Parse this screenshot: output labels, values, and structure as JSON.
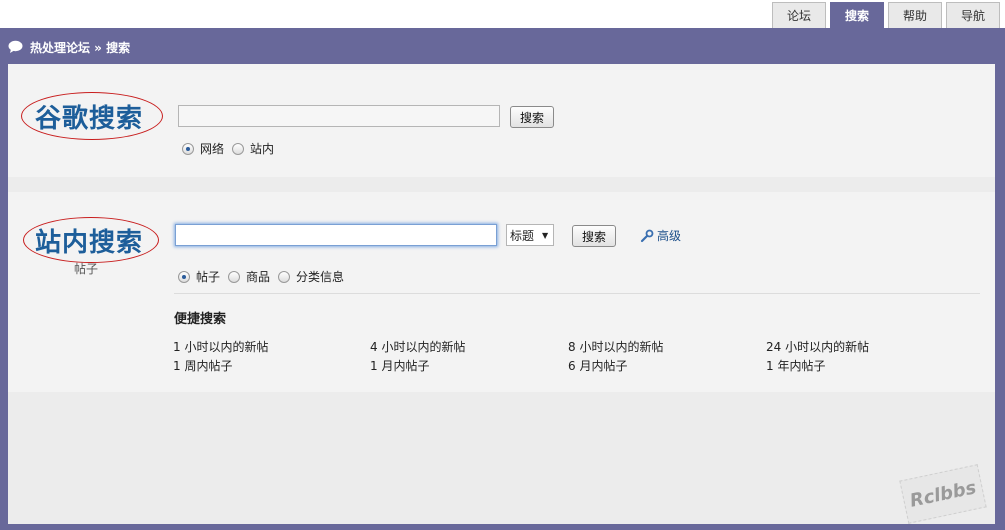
{
  "tabs": [
    {
      "label": "论坛"
    },
    {
      "label": "搜索"
    },
    {
      "label": "帮助"
    },
    {
      "label": "导航"
    }
  ],
  "breadcrumb": {
    "text": "热处理论坛 » 搜索"
  },
  "google_search": {
    "title": "谷歌搜索",
    "button": "搜索",
    "options": [
      "网络",
      "站内"
    ],
    "selected": "网络"
  },
  "site_search": {
    "title": "站内搜索",
    "sublabel": "帖子",
    "select_value": "标题",
    "button": "搜索",
    "advanced": "高级",
    "options": [
      "帖子",
      "商品",
      "分类信息"
    ],
    "selected": "帖子"
  },
  "quick_search": {
    "title": "便捷搜索",
    "links": [
      [
        "1 小时以内的新帖",
        "4 小时以内的新帖",
        "8 小时以内的新帖",
        "24 小时以内的新帖"
      ],
      [
        "1 周内帖子",
        "1 月内帖子",
        "6 月内帖子",
        "1 年内帖子"
      ]
    ]
  },
  "watermark": "Rclbbs",
  "colors": {
    "frame": "#68689a",
    "title_blue": "#1d5e9a",
    "oval_red": "#c81e1e"
  }
}
